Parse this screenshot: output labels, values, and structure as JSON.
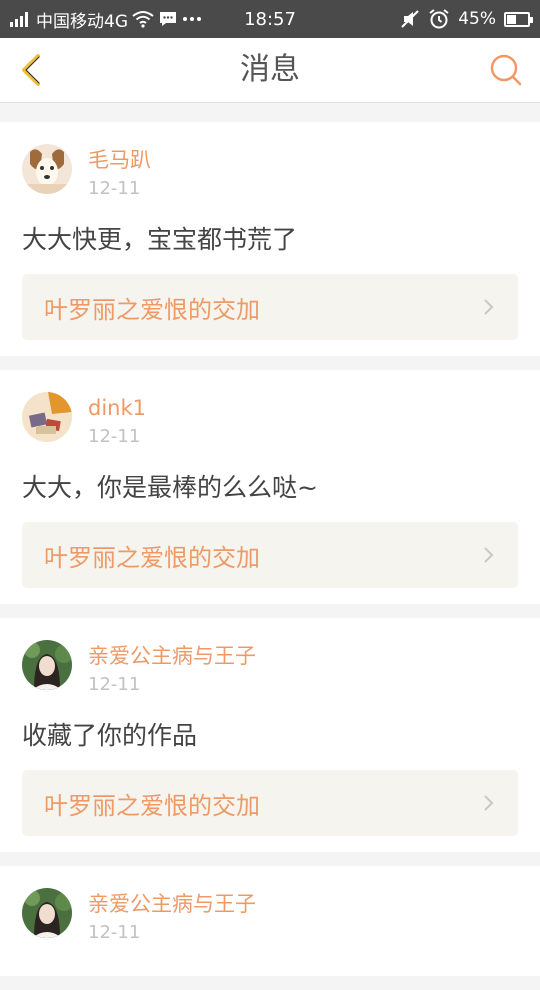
{
  "status_bar": {
    "carrier": "中国移动4G",
    "time": "18:57",
    "battery": "45%",
    "battery_level": 0.45,
    "icons": [
      "signal-icon",
      "wifi-icon",
      "message-icon",
      "more-dots-icon",
      "mute-icon",
      "alarm-icon",
      "battery-icon"
    ]
  },
  "nav": {
    "title": "消息",
    "back_icon": "chevron-left-icon",
    "search_icon": "search-icon",
    "accent": "#ef9a66"
  },
  "messages": [
    {
      "username": "毛马趴",
      "date": "12-11",
      "content": "大大快更，宝宝都书荒了",
      "book": "叶罗丽之爱恨的交加",
      "avatar": "dog-photo-avatar"
    },
    {
      "username": "dink1",
      "date": "12-11",
      "content": "大大，你是最棒的么么哒~",
      "book": "叶罗丽之爱恨的交加",
      "avatar": "scenery-photo-avatar"
    },
    {
      "username": "亲爱公主病与王子",
      "date": "12-11",
      "content": "收藏了你的作品",
      "book": "叶罗丽之爱恨的交加",
      "avatar": "girl-photo-avatar"
    },
    {
      "username": "亲爱公主病与王子",
      "date": "12-11",
      "avatar": "girl-photo-avatar"
    }
  ]
}
